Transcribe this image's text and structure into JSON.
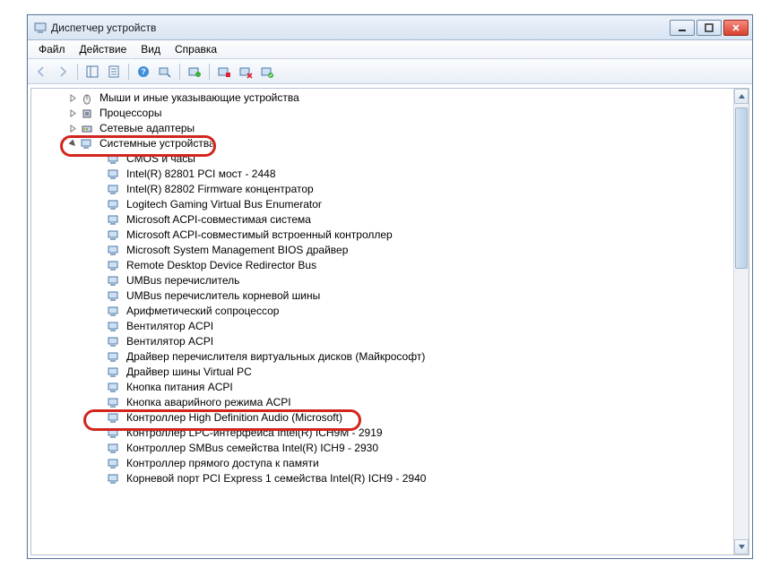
{
  "window": {
    "title": "Диспетчер устройств"
  },
  "menu": {
    "file": "Файл",
    "action": "Действие",
    "view": "Вид",
    "help": "Справка"
  },
  "tree": {
    "top_collapsed": [
      "Мыши и иные указывающие устройства",
      "Процессоры",
      "Сетевые адаптеры"
    ],
    "system_devices_label": "Системные устройства",
    "system_children": [
      "CMOS и часы",
      "Intel(R) 82801 PCI мост - 2448",
      "Intel(R) 82802 Firmware концентратор",
      "Logitech Gaming Virtual Bus Enumerator",
      "Microsoft ACPI-совместимая система",
      "Microsoft ACPI-совместимый встроенный контроллер",
      "Microsoft System Management BIOS драйвер",
      "Remote Desktop Device Redirector Bus",
      "UMBus перечислитель",
      "UMBus перечислитель корневой шины",
      "Арифметический сопроцессор",
      "Вентилятор ACPI",
      "Вентилятор ACPI",
      "Драйвер перечислителя виртуальных дисков (Майкрософт)",
      "Драйвер шины Virtual PC",
      "Кнопка питания ACPI",
      "Кнопка аварийного режима ACPI",
      "Контроллер High Definition Audio (Microsoft)",
      "Контроллер LPC-интерфейса Intel(R) ICH9M - 2919",
      "Контроллер SMBus семейства Intel(R) ICH9 - 2930",
      "Контроллер прямого доступа к памяти",
      "Корневой порт PCI Express 1 семейства Intel(R) ICH9 - 2940"
    ],
    "highlighted_child_index": 17
  }
}
